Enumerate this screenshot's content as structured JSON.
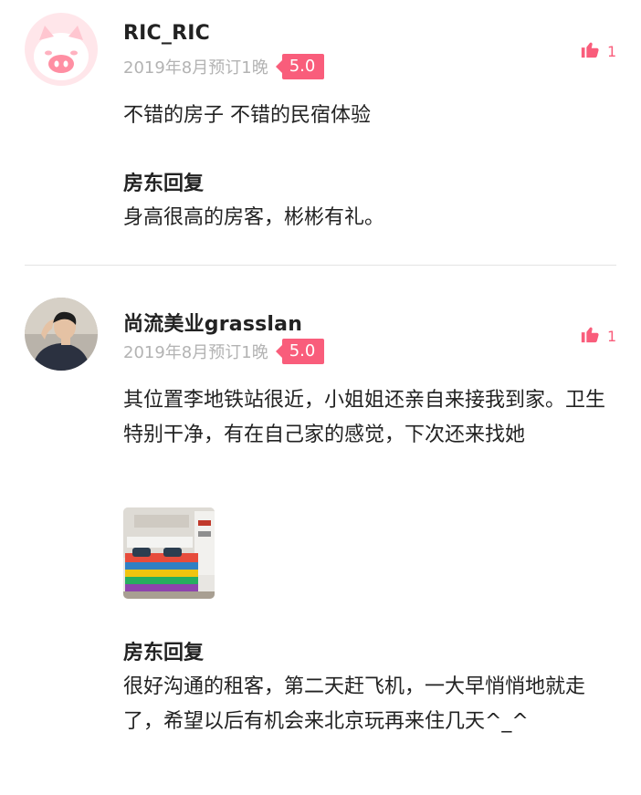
{
  "reviews": [
    {
      "username": "RIC_RIC",
      "date": "2019年8月预订1晚",
      "score": "5.0",
      "likes": "1",
      "text": "不错的房子 不错的民宿体验",
      "reply_title": "房东回复",
      "reply_text": "身高很高的房客，彬彬有礼。",
      "avatar": "pig-avatar"
    },
    {
      "username": "尚流美业grasslan",
      "date": "2019年8月预订1晚",
      "score": "5.0",
      "likes": "1",
      "text": "其位置李地铁站很近，小姐姐还亲自来接我到家。卫生特别干净，有在自己家的感觉，下次还来找她",
      "reply_title": "房东回复",
      "reply_text": "很好沟通的租客，第二天赶飞机，一大早悄悄地就走了，希望以后有机会来北京玩再来住几天^_^",
      "avatar": "person-photo-avatar",
      "photos": [
        "bedroom-photo"
      ]
    }
  ],
  "colors": {
    "accent": "#f95d7b",
    "meta_text": "#b3b3b3",
    "body_text": "#222222",
    "divider": "#e3e3e3"
  },
  "icons": {
    "like": "thumbs-up-icon"
  }
}
